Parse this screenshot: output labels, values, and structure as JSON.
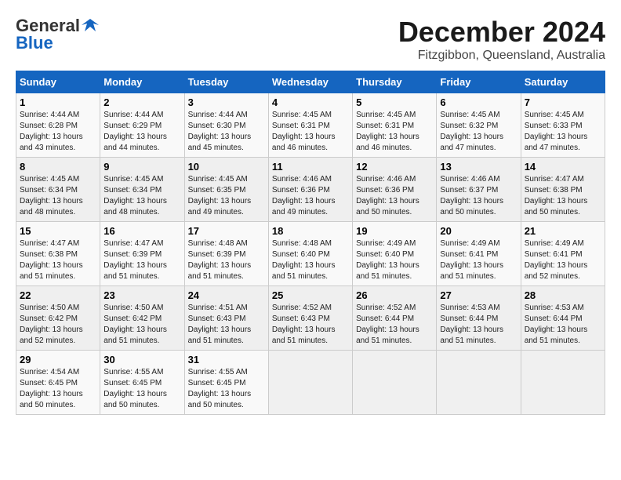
{
  "header": {
    "logo_line1": "General",
    "logo_line2": "Blue",
    "month_title": "December 2024",
    "location": "Fitzgibbon, Queensland, Australia"
  },
  "calendar": {
    "days_of_week": [
      "Sunday",
      "Monday",
      "Tuesday",
      "Wednesday",
      "Thursday",
      "Friday",
      "Saturday"
    ],
    "weeks": [
      [
        {
          "day": "",
          "sunrise": "",
          "sunset": "",
          "daylight": ""
        },
        {
          "day": "2",
          "sunrise": "Sunrise: 4:44 AM",
          "sunset": "Sunset: 6:29 PM",
          "daylight": "Daylight: 13 hours and 44 minutes."
        },
        {
          "day": "3",
          "sunrise": "Sunrise: 4:44 AM",
          "sunset": "Sunset: 6:30 PM",
          "daylight": "Daylight: 13 hours and 45 minutes."
        },
        {
          "day": "4",
          "sunrise": "Sunrise: 4:45 AM",
          "sunset": "Sunset: 6:31 PM",
          "daylight": "Daylight: 13 hours and 46 minutes."
        },
        {
          "day": "5",
          "sunrise": "Sunrise: 4:45 AM",
          "sunset": "Sunset: 6:31 PM",
          "daylight": "Daylight: 13 hours and 46 minutes."
        },
        {
          "day": "6",
          "sunrise": "Sunrise: 4:45 AM",
          "sunset": "Sunset: 6:32 PM",
          "daylight": "Daylight: 13 hours and 47 minutes."
        },
        {
          "day": "7",
          "sunrise": "Sunrise: 4:45 AM",
          "sunset": "Sunset: 6:33 PM",
          "daylight": "Daylight: 13 hours and 47 minutes."
        }
      ],
      [
        {
          "day": "1",
          "sunrise": "Sunrise: 4:44 AM",
          "sunset": "Sunset: 6:28 PM",
          "daylight": "Daylight: 13 hours and 43 minutes."
        },
        {
          "day": "",
          "sunrise": "",
          "sunset": "",
          "daylight": ""
        },
        {
          "day": "",
          "sunrise": "",
          "sunset": "",
          "daylight": ""
        },
        {
          "day": "",
          "sunrise": "",
          "sunset": "",
          "daylight": ""
        },
        {
          "day": "",
          "sunrise": "",
          "sunset": "",
          "daylight": ""
        },
        {
          "day": "",
          "sunrise": "",
          "sunset": "",
          "daylight": ""
        },
        {
          "day": "",
          "sunrise": "",
          "sunset": "",
          "daylight": ""
        }
      ],
      [
        {
          "day": "8",
          "sunrise": "Sunrise: 4:45 AM",
          "sunset": "Sunset: 6:34 PM",
          "daylight": "Daylight: 13 hours and 48 minutes."
        },
        {
          "day": "9",
          "sunrise": "Sunrise: 4:45 AM",
          "sunset": "Sunset: 6:34 PM",
          "daylight": "Daylight: 13 hours and 48 minutes."
        },
        {
          "day": "10",
          "sunrise": "Sunrise: 4:45 AM",
          "sunset": "Sunset: 6:35 PM",
          "daylight": "Daylight: 13 hours and 49 minutes."
        },
        {
          "day": "11",
          "sunrise": "Sunrise: 4:46 AM",
          "sunset": "Sunset: 6:36 PM",
          "daylight": "Daylight: 13 hours and 49 minutes."
        },
        {
          "day": "12",
          "sunrise": "Sunrise: 4:46 AM",
          "sunset": "Sunset: 6:36 PM",
          "daylight": "Daylight: 13 hours and 50 minutes."
        },
        {
          "day": "13",
          "sunrise": "Sunrise: 4:46 AM",
          "sunset": "Sunset: 6:37 PM",
          "daylight": "Daylight: 13 hours and 50 minutes."
        },
        {
          "day": "14",
          "sunrise": "Sunrise: 4:47 AM",
          "sunset": "Sunset: 6:38 PM",
          "daylight": "Daylight: 13 hours and 50 minutes."
        }
      ],
      [
        {
          "day": "15",
          "sunrise": "Sunrise: 4:47 AM",
          "sunset": "Sunset: 6:38 PM",
          "daylight": "Daylight: 13 hours and 51 minutes."
        },
        {
          "day": "16",
          "sunrise": "Sunrise: 4:47 AM",
          "sunset": "Sunset: 6:39 PM",
          "daylight": "Daylight: 13 hours and 51 minutes."
        },
        {
          "day": "17",
          "sunrise": "Sunrise: 4:48 AM",
          "sunset": "Sunset: 6:39 PM",
          "daylight": "Daylight: 13 hours and 51 minutes."
        },
        {
          "day": "18",
          "sunrise": "Sunrise: 4:48 AM",
          "sunset": "Sunset: 6:40 PM",
          "daylight": "Daylight: 13 hours and 51 minutes."
        },
        {
          "day": "19",
          "sunrise": "Sunrise: 4:49 AM",
          "sunset": "Sunset: 6:40 PM",
          "daylight": "Daylight: 13 hours and 51 minutes."
        },
        {
          "day": "20",
          "sunrise": "Sunrise: 4:49 AM",
          "sunset": "Sunset: 6:41 PM",
          "daylight": "Daylight: 13 hours and 51 minutes."
        },
        {
          "day": "21",
          "sunrise": "Sunrise: 4:49 AM",
          "sunset": "Sunset: 6:41 PM",
          "daylight": "Daylight: 13 hours and 52 minutes."
        }
      ],
      [
        {
          "day": "22",
          "sunrise": "Sunrise: 4:50 AM",
          "sunset": "Sunset: 6:42 PM",
          "daylight": "Daylight: 13 hours and 52 minutes."
        },
        {
          "day": "23",
          "sunrise": "Sunrise: 4:50 AM",
          "sunset": "Sunset: 6:42 PM",
          "daylight": "Daylight: 13 hours and 51 minutes."
        },
        {
          "day": "24",
          "sunrise": "Sunrise: 4:51 AM",
          "sunset": "Sunset: 6:43 PM",
          "daylight": "Daylight: 13 hours and 51 minutes."
        },
        {
          "day": "25",
          "sunrise": "Sunrise: 4:52 AM",
          "sunset": "Sunset: 6:43 PM",
          "daylight": "Daylight: 13 hours and 51 minutes."
        },
        {
          "day": "26",
          "sunrise": "Sunrise: 4:52 AM",
          "sunset": "Sunset: 6:44 PM",
          "daylight": "Daylight: 13 hours and 51 minutes."
        },
        {
          "day": "27",
          "sunrise": "Sunrise: 4:53 AM",
          "sunset": "Sunset: 6:44 PM",
          "daylight": "Daylight: 13 hours and 51 minutes."
        },
        {
          "day": "28",
          "sunrise": "Sunrise: 4:53 AM",
          "sunset": "Sunset: 6:44 PM",
          "daylight": "Daylight: 13 hours and 51 minutes."
        }
      ],
      [
        {
          "day": "29",
          "sunrise": "Sunrise: 4:54 AM",
          "sunset": "Sunset: 6:45 PM",
          "daylight": "Daylight: 13 hours and 50 minutes."
        },
        {
          "day": "30",
          "sunrise": "Sunrise: 4:55 AM",
          "sunset": "Sunset: 6:45 PM",
          "daylight": "Daylight: 13 hours and 50 minutes."
        },
        {
          "day": "31",
          "sunrise": "Sunrise: 4:55 AM",
          "sunset": "Sunset: 6:45 PM",
          "daylight": "Daylight: 13 hours and 50 minutes."
        },
        {
          "day": "",
          "sunrise": "",
          "sunset": "",
          "daylight": ""
        },
        {
          "day": "",
          "sunrise": "",
          "sunset": "",
          "daylight": ""
        },
        {
          "day": "",
          "sunrise": "",
          "sunset": "",
          "daylight": ""
        },
        {
          "day": "",
          "sunrise": "",
          "sunset": "",
          "daylight": ""
        }
      ]
    ]
  }
}
